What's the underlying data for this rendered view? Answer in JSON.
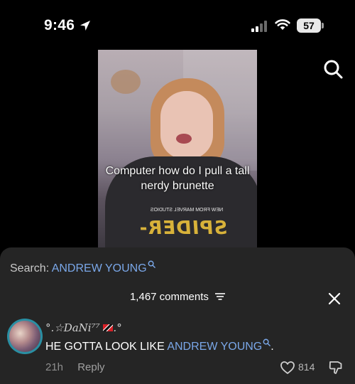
{
  "status_bar": {
    "time": "9:46",
    "battery": "57"
  },
  "video": {
    "caption": "Computer how do I pull a tall nerdy brunette",
    "shirt_text": "SPIDER-MAN",
    "shirt_small": "NEW FROM MARVEL STUDIOS"
  },
  "comments": {
    "search_prefix": "Search: ",
    "search_keyword": "ANDREW YOUNG",
    "count_label": "1,467 comments",
    "items": [
      {
        "username": "°.☆DaNi⁷⁷",
        "username_suffix": ".°",
        "text_prefix": "HE GOTTA LOOK LIKE ",
        "text_keyword": "ANDREW YOUNG",
        "text_suffix": ".",
        "time": "21h",
        "reply_label": "Reply",
        "likes": "814"
      }
    ]
  },
  "colors": {
    "accent_link": "#7aa7e8",
    "sheet_background": "#252525",
    "avatar_ring": "#2a8fa3"
  },
  "icons": [
    "location-arrow-icon",
    "cell-signal-icon",
    "wifi-icon",
    "battery-icon",
    "search-icon",
    "sort-icon",
    "close-icon",
    "heart-icon",
    "thumbs-down-icon"
  ]
}
